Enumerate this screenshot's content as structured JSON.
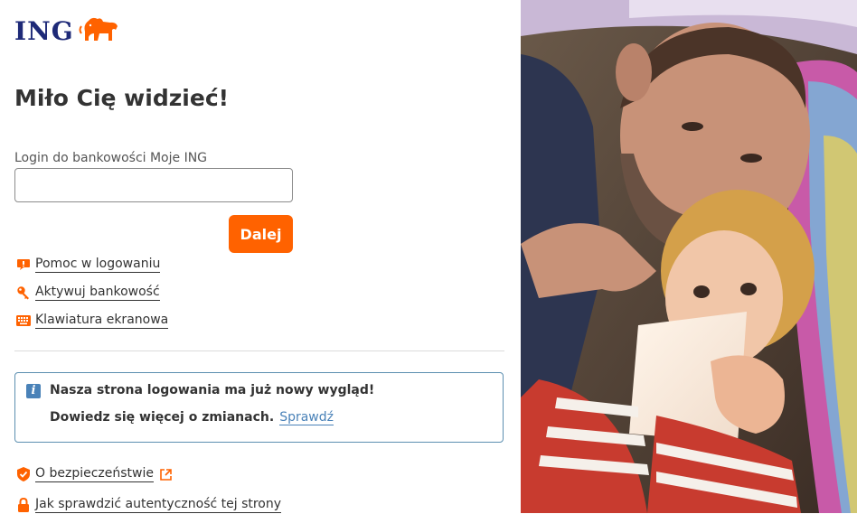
{
  "brand": {
    "logo_text": "ING",
    "accent": "#ff6200",
    "navy": "#1e2a78"
  },
  "page": {
    "title": "Miło Cię widzieć!"
  },
  "login": {
    "label": "Login do bankowości Moje ING",
    "value": "",
    "next_label": "Dalej"
  },
  "links": {
    "help": {
      "label": "Pomoc w logowaniu",
      "icon": "speech-bubble-icon"
    },
    "activate": {
      "label": "Aktywuj bankowość",
      "icon": "key-icon"
    },
    "keyboard": {
      "label": "Klawiatura ekranowa",
      "icon": "keyboard-icon"
    }
  },
  "info": {
    "title": "Nasza strona logowania ma już nowy wygląd!",
    "text": "Dowiedz się więcej o zmianach.",
    "link": "Sprawdź",
    "icon": "info-icon"
  },
  "footer_links": {
    "security": {
      "label": "O bezpieczeństwie",
      "icon": "shield-icon",
      "external_icon": "external-link-icon"
    },
    "authenticity": {
      "label": "Jak sprawdzić autentyczność tej strony",
      "icon": "lock-icon"
    }
  }
}
